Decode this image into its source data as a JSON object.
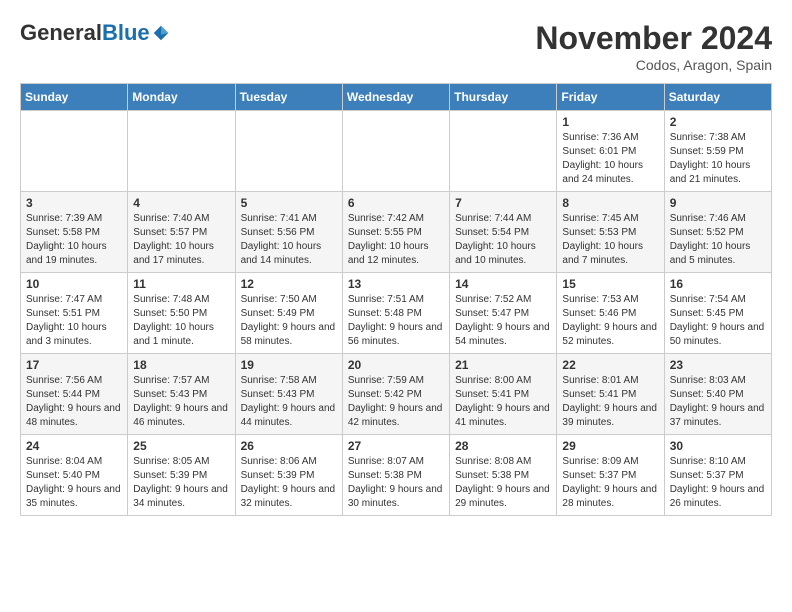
{
  "header": {
    "logo_general": "General",
    "logo_blue": "Blue",
    "month_title": "November 2024",
    "location": "Codos, Aragon, Spain"
  },
  "days_of_week": [
    "Sunday",
    "Monday",
    "Tuesday",
    "Wednesday",
    "Thursday",
    "Friday",
    "Saturday"
  ],
  "weeks": [
    [
      {
        "day": "",
        "info": ""
      },
      {
        "day": "",
        "info": ""
      },
      {
        "day": "",
        "info": ""
      },
      {
        "day": "",
        "info": ""
      },
      {
        "day": "",
        "info": ""
      },
      {
        "day": "1",
        "info": "Sunrise: 7:36 AM\nSunset: 6:01 PM\nDaylight: 10 hours and 24 minutes."
      },
      {
        "day": "2",
        "info": "Sunrise: 7:38 AM\nSunset: 5:59 PM\nDaylight: 10 hours and 21 minutes."
      }
    ],
    [
      {
        "day": "3",
        "info": "Sunrise: 7:39 AM\nSunset: 5:58 PM\nDaylight: 10 hours and 19 minutes."
      },
      {
        "day": "4",
        "info": "Sunrise: 7:40 AM\nSunset: 5:57 PM\nDaylight: 10 hours and 17 minutes."
      },
      {
        "day": "5",
        "info": "Sunrise: 7:41 AM\nSunset: 5:56 PM\nDaylight: 10 hours and 14 minutes."
      },
      {
        "day": "6",
        "info": "Sunrise: 7:42 AM\nSunset: 5:55 PM\nDaylight: 10 hours and 12 minutes."
      },
      {
        "day": "7",
        "info": "Sunrise: 7:44 AM\nSunset: 5:54 PM\nDaylight: 10 hours and 10 minutes."
      },
      {
        "day": "8",
        "info": "Sunrise: 7:45 AM\nSunset: 5:53 PM\nDaylight: 10 hours and 7 minutes."
      },
      {
        "day": "9",
        "info": "Sunrise: 7:46 AM\nSunset: 5:52 PM\nDaylight: 10 hours and 5 minutes."
      }
    ],
    [
      {
        "day": "10",
        "info": "Sunrise: 7:47 AM\nSunset: 5:51 PM\nDaylight: 10 hours and 3 minutes."
      },
      {
        "day": "11",
        "info": "Sunrise: 7:48 AM\nSunset: 5:50 PM\nDaylight: 10 hours and 1 minute."
      },
      {
        "day": "12",
        "info": "Sunrise: 7:50 AM\nSunset: 5:49 PM\nDaylight: 9 hours and 58 minutes."
      },
      {
        "day": "13",
        "info": "Sunrise: 7:51 AM\nSunset: 5:48 PM\nDaylight: 9 hours and 56 minutes."
      },
      {
        "day": "14",
        "info": "Sunrise: 7:52 AM\nSunset: 5:47 PM\nDaylight: 9 hours and 54 minutes."
      },
      {
        "day": "15",
        "info": "Sunrise: 7:53 AM\nSunset: 5:46 PM\nDaylight: 9 hours and 52 minutes."
      },
      {
        "day": "16",
        "info": "Sunrise: 7:54 AM\nSunset: 5:45 PM\nDaylight: 9 hours and 50 minutes."
      }
    ],
    [
      {
        "day": "17",
        "info": "Sunrise: 7:56 AM\nSunset: 5:44 PM\nDaylight: 9 hours and 48 minutes."
      },
      {
        "day": "18",
        "info": "Sunrise: 7:57 AM\nSunset: 5:43 PM\nDaylight: 9 hours and 46 minutes."
      },
      {
        "day": "19",
        "info": "Sunrise: 7:58 AM\nSunset: 5:43 PM\nDaylight: 9 hours and 44 minutes."
      },
      {
        "day": "20",
        "info": "Sunrise: 7:59 AM\nSunset: 5:42 PM\nDaylight: 9 hours and 42 minutes."
      },
      {
        "day": "21",
        "info": "Sunrise: 8:00 AM\nSunset: 5:41 PM\nDaylight: 9 hours and 41 minutes."
      },
      {
        "day": "22",
        "info": "Sunrise: 8:01 AM\nSunset: 5:41 PM\nDaylight: 9 hours and 39 minutes."
      },
      {
        "day": "23",
        "info": "Sunrise: 8:03 AM\nSunset: 5:40 PM\nDaylight: 9 hours and 37 minutes."
      }
    ],
    [
      {
        "day": "24",
        "info": "Sunrise: 8:04 AM\nSunset: 5:40 PM\nDaylight: 9 hours and 35 minutes."
      },
      {
        "day": "25",
        "info": "Sunrise: 8:05 AM\nSunset: 5:39 PM\nDaylight: 9 hours and 34 minutes."
      },
      {
        "day": "26",
        "info": "Sunrise: 8:06 AM\nSunset: 5:39 PM\nDaylight: 9 hours and 32 minutes."
      },
      {
        "day": "27",
        "info": "Sunrise: 8:07 AM\nSunset: 5:38 PM\nDaylight: 9 hours and 30 minutes."
      },
      {
        "day": "28",
        "info": "Sunrise: 8:08 AM\nSunset: 5:38 PM\nDaylight: 9 hours and 29 minutes."
      },
      {
        "day": "29",
        "info": "Sunrise: 8:09 AM\nSunset: 5:37 PM\nDaylight: 9 hours and 28 minutes."
      },
      {
        "day": "30",
        "info": "Sunrise: 8:10 AM\nSunset: 5:37 PM\nDaylight: 9 hours and 26 minutes."
      }
    ]
  ]
}
